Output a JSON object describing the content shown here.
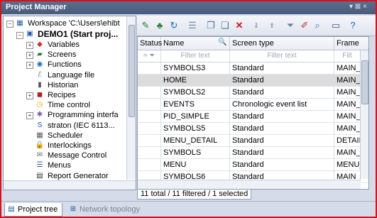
{
  "window": {
    "title": "Project Manager",
    "controls": "▾ ⊠ ×"
  },
  "tree": {
    "workspace": "Workspace 'C:\\Users\\ehibt",
    "project": "DEMO1 (Start proj...",
    "items": [
      {
        "label": "Variables",
        "icon": "variables-icon",
        "glyph": "◆",
        "color": "#c0392b"
      },
      {
        "label": "Screens",
        "icon": "screens-icon",
        "glyph": "▰",
        "color": "#2e7d32"
      },
      {
        "label": "Functions",
        "icon": "functions-icon",
        "glyph": "◉",
        "color": "#1565c0"
      },
      {
        "label": "Language file",
        "icon": "language-file-icon",
        "glyph": "ℰ",
        "color": "#4a6fa5"
      },
      {
        "label": "Historian",
        "icon": "historian-icon",
        "glyph": "▮",
        "color": "#555"
      },
      {
        "label": "Recipes",
        "icon": "recipes-icon",
        "glyph": "◼",
        "color": "#b71c1c"
      },
      {
        "label": "Time control",
        "icon": "time-control-icon",
        "glyph": "◷",
        "color": "#e6a800"
      },
      {
        "label": "Programming interfa",
        "icon": "programming-interface-icon",
        "glyph": "✱",
        "color": "#7b5ea7"
      },
      {
        "label": "straton (IEC 6113...",
        "icon": "straton-icon",
        "glyph": "S",
        "color": "#1e4fa0"
      },
      {
        "label": "Scheduler",
        "icon": "scheduler-icon",
        "glyph": "▦",
        "color": "#555"
      },
      {
        "label": "Interlockings",
        "icon": "interlockings-icon",
        "glyph": "🔒",
        "color": "#d4a017"
      },
      {
        "label": "Message Control",
        "icon": "message-control-icon",
        "glyph": "✉",
        "color": "#666"
      },
      {
        "label": "Menus",
        "icon": "menus-icon",
        "glyph": "☰",
        "color": "#33507a"
      },
      {
        "label": "Report Generator",
        "icon": "report-generator-icon",
        "glyph": "▤",
        "color": "#333"
      }
    ]
  },
  "grid": {
    "columns": {
      "status": "Status",
      "name": "Name",
      "type": "Screen type",
      "frame": "Frame"
    },
    "filter_placeholder": "Filter text",
    "filter_short": "Filt",
    "rows": [
      {
        "name": "SYMBOLS3",
        "type": "Standard",
        "frame": "MAIN_"
      },
      {
        "name": "HOME",
        "type": "Standard",
        "frame": "MAIN_"
      },
      {
        "name": "SYMBOLS2",
        "type": "Standard",
        "frame": "MAIN_"
      },
      {
        "name": "EVENTS",
        "type": "Chronologic event list",
        "frame": "MAIN_"
      },
      {
        "name": "PID_SIMPLE",
        "type": "Standard",
        "frame": "MAIN_"
      },
      {
        "name": "SYMBOLS5",
        "type": "Standard",
        "frame": "MAIN_"
      },
      {
        "name": "MENU_DETAIL",
        "type": "Standard",
        "frame": "DETAIL"
      },
      {
        "name": "SYMBOLS",
        "type": "Standard",
        "frame": "MAIN_"
      },
      {
        "name": "MENU",
        "type": "Standard",
        "frame": "MENU_"
      },
      {
        "name": "SYMBOLS6",
        "type": "Standard",
        "frame": "MAIN"
      }
    ],
    "status_text": "11 total / 11 filtered / 1 selected"
  },
  "tabs": {
    "project_tree": "Project tree",
    "network": "Network topology"
  }
}
